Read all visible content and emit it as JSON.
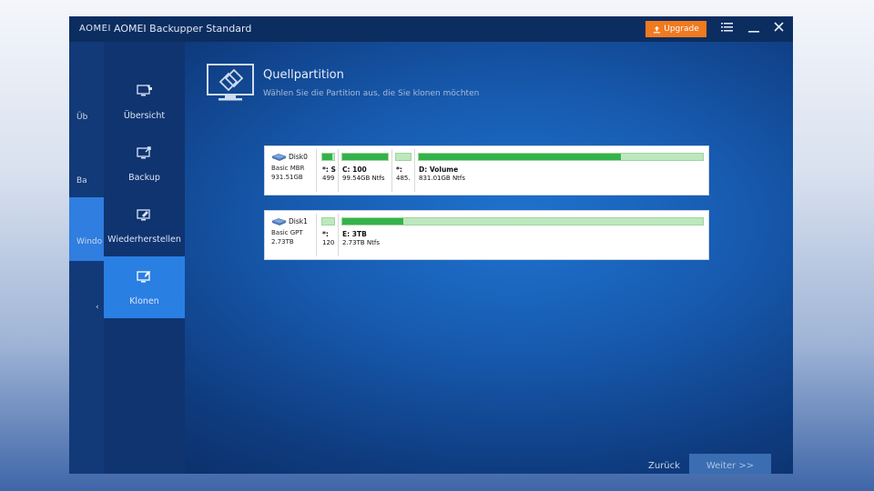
{
  "titlebar": {
    "brand": "AOMEI",
    "title": "AOMEI Backupper Standard",
    "upgrade_label": "Upgrade",
    "menu_icon": "menu-icon",
    "minimize_icon": "minimize-icon",
    "close_icon": "close-icon"
  },
  "outer_sidebar": {
    "items": [
      {
        "label": "Üb"
      },
      {
        "label": "Ba"
      },
      {
        "label": "Windo"
      },
      {
        "label": "‹"
      }
    ]
  },
  "sidebar": {
    "items": [
      {
        "label": "Übersicht",
        "icon": "overview-icon",
        "active": false
      },
      {
        "label": "Backup",
        "icon": "backup-icon",
        "active": false
      },
      {
        "label": "Wiederherstellen",
        "icon": "restore-icon",
        "active": false
      },
      {
        "label": "Klonen",
        "icon": "clone-icon",
        "active": true
      }
    ]
  },
  "header": {
    "title": "Quellpartition",
    "subtitle": "Wählen Sie die Partition aus, die Sie klonen möchten"
  },
  "disks": [
    {
      "name": "Disk0",
      "type": "Basic MBR",
      "size": "931.51GB",
      "partitions": [
        {
          "name": "*: S",
          "size": "499",
          "fill": 0.85
        },
        {
          "name": "C: 100",
          "size": "99.54GB Ntfs",
          "fill": 1.0
        },
        {
          "name": "*:",
          "size": "485.",
          "fill": 0.0
        },
        {
          "name": "D: Volume",
          "size": "831.01GB Ntfs",
          "fill": 0.71
        }
      ]
    },
    {
      "name": "Disk1",
      "type": "Basic GPT",
      "size": "2.73TB",
      "partitions": [
        {
          "name": "*:",
          "size": "120",
          "fill": 0.0
        },
        {
          "name": "E: 3TB",
          "size": "2.73TB Ntfs",
          "fill": 0.17
        }
      ]
    }
  ],
  "footer": {
    "back_label": "Zurück",
    "next_label": "Weiter >>"
  },
  "colors": {
    "accent": "#2a7fe3",
    "upgrade": "#f07a1f",
    "partition_used": "#34b34a",
    "partition_free": "#bde8bd"
  }
}
